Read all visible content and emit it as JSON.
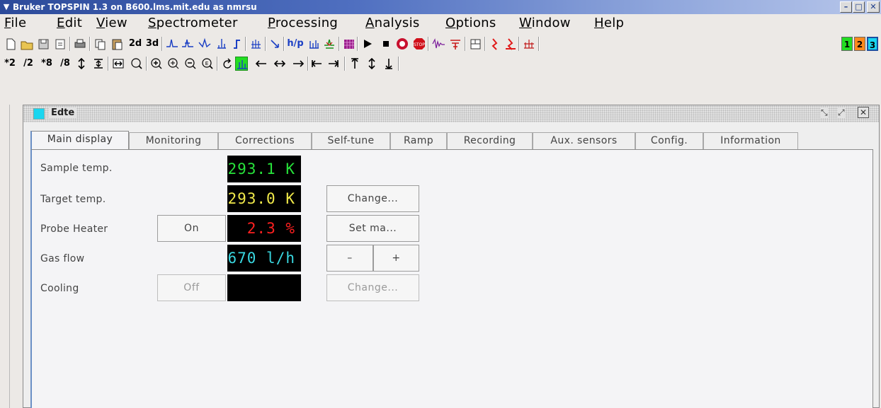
{
  "window": {
    "title": "Bruker TOPSPIN 1.3 on B600.lms.mit.edu as nmrsu",
    "menu_icon": "chevron-down-icon",
    "minimize_label": "–",
    "maximize_label": "□",
    "close_label": "✕"
  },
  "menubar": {
    "items": [
      {
        "first": "F",
        "rest": "ile"
      },
      {
        "first": "E",
        "rest": "dit"
      },
      {
        "first": "V",
        "rest": "iew"
      },
      {
        "first": "S",
        "rest": "pectrometer"
      },
      {
        "first": "P",
        "rest": "rocessing"
      },
      {
        "first": "A",
        "rest": "nalysis"
      },
      {
        "first": "O",
        "rest": "ptions"
      },
      {
        "first": "W",
        "rest": "indow"
      },
      {
        "first": "H",
        "rest": "elp"
      }
    ]
  },
  "toolbar1": {
    "btn_2d": "2d",
    "btn_3d": "3d",
    "btn_hp": "h/p",
    "window_1": "1",
    "window_2": "2",
    "window_3": "3",
    "colors": {
      "w1": "#22dd22",
      "w2": "#ff8a1c",
      "w3": "#19d6f0"
    }
  },
  "toolbar2": {
    "x2": "*2",
    "d2": "/2",
    "x8": "*8",
    "d8": "/8"
  },
  "inner_window": {
    "title": "Edte"
  },
  "tabs": [
    {
      "label": "Main display",
      "active": true
    },
    {
      "label": "Monitoring"
    },
    {
      "label": "Corrections"
    },
    {
      "label": "Self-tune"
    },
    {
      "label": "Ramp"
    },
    {
      "label": "Recording"
    },
    {
      "label": "Aux. sensors"
    },
    {
      "label": "Config."
    },
    {
      "label": "Information"
    }
  ],
  "main": {
    "sample_temp": {
      "label": "Sample temp.",
      "value": "293.1 K",
      "color": "#27e23a"
    },
    "target_temp": {
      "label": "Target temp.",
      "value": "293.0 K",
      "color": "#f0e94a",
      "button": "Change..."
    },
    "probe_heater": {
      "label": "Probe Heater",
      "toggle": "On",
      "value": "2.3 %",
      "color": "#ff2020",
      "button": "Set ma..."
    },
    "gas_flow": {
      "label": "Gas flow",
      "value": "670 l/h",
      "color": "#39d7e0",
      "minus": "–",
      "plus": "+"
    },
    "cooling": {
      "label": "Cooling",
      "toggle": "Off",
      "value": "",
      "button": "Change..."
    }
  }
}
